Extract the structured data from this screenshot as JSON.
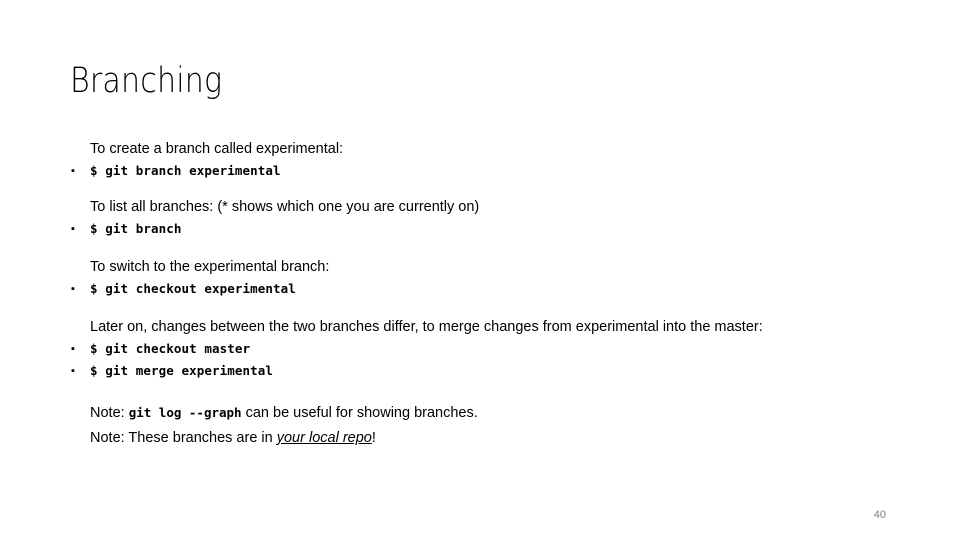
{
  "slide": {
    "title": "Branching",
    "page_number": "40",
    "bullet_glyph": "▪",
    "text_color": "#000000",
    "page_number_color": "#808080",
    "background_color": "#ffffff"
  },
  "groups": [
    {
      "lead": "To create a branch called experimental:",
      "commands": [
        "$ git branch experimental"
      ]
    },
    {
      "lead": "To list all branches: (* shows which one you are currently on)",
      "commands": [
        "$ git branch"
      ]
    },
    {
      "lead": "To switch to the experimental branch:",
      "commands": [
        "$ git checkout experimental"
      ]
    },
    {
      "lead": "Later on, changes between the two branches differ, to merge changes from experimental into the master:",
      "commands": [
        "$ git checkout master",
        "$ git merge experimental"
      ]
    }
  ],
  "notes": {
    "note1": {
      "prefix": "Note: ",
      "mono": "git log --graph",
      "suffix": " can be useful for showing branches."
    },
    "note2": {
      "prefix": "Note: These branches are in ",
      "emphasis": "your local repo",
      "suffix": "!"
    }
  }
}
